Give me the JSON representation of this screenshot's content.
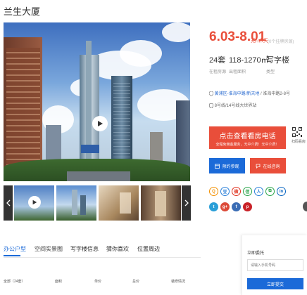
{
  "page_title": "兰生大厦",
  "price": {
    "range": "6.03-8.01",
    "unit": "元/㎡/天",
    "note": "(0个挂牌房源)"
  },
  "stats": [
    {
      "value": "24套",
      "label": "在租房源"
    },
    {
      "value": "118-1270㎡",
      "label": "出租面积"
    },
    {
      "value": "写字楼",
      "label": "类型"
    }
  ],
  "address": {
    "district": "黄浦区-淮海中路/新天地",
    "street": "/ 淮海中路2-8号"
  },
  "metro": "8号线/14号线大世界站",
  "call_button": {
    "label": "点击查看看房电话",
    "sub": "全程免佣金服务，无中介费！无中介费！"
  },
  "qr_label": "扫码看房",
  "buttons": {
    "visit": "预约参观",
    "consult": "在线咨询"
  },
  "share_icons": [
    {
      "name": "qzone-share-icon",
      "glyph": "Q"
    },
    {
      "name": "douban-share-icon",
      "glyph": "豆"
    },
    {
      "name": "weibo-share-icon",
      "glyph": "微"
    },
    {
      "name": "wechat-share-icon",
      "glyph": "信"
    },
    {
      "name": "renren-share-icon",
      "glyph": "人"
    },
    {
      "name": "copy-link-share-icon",
      "glyph": "⧉"
    },
    {
      "name": "linkedin-share-icon",
      "glyph": "in"
    },
    {
      "name": "twitter-share-icon",
      "glyph": "t"
    },
    {
      "name": "google-plus-share-icon",
      "glyph": "g+"
    },
    {
      "name": "facebook-share-icon",
      "glyph": "f"
    },
    {
      "name": "pinterest-share-icon",
      "glyph": "p"
    }
  ],
  "tabs": [
    "办公户型",
    "空间实景图",
    "写字楼信息",
    "猜你喜欢",
    "位置周边"
  ],
  "table_headers": [
    "全部（24套）",
    "面积",
    "单价",
    "总价",
    "装修情况"
  ],
  "commission_panel": {
    "title": "立即委托",
    "placeholder": "请输入手机号码",
    "submit": "立即提交"
  },
  "colors": {
    "price_red": "#e94e3a",
    "brand_blue": "#1b6ad8"
  }
}
